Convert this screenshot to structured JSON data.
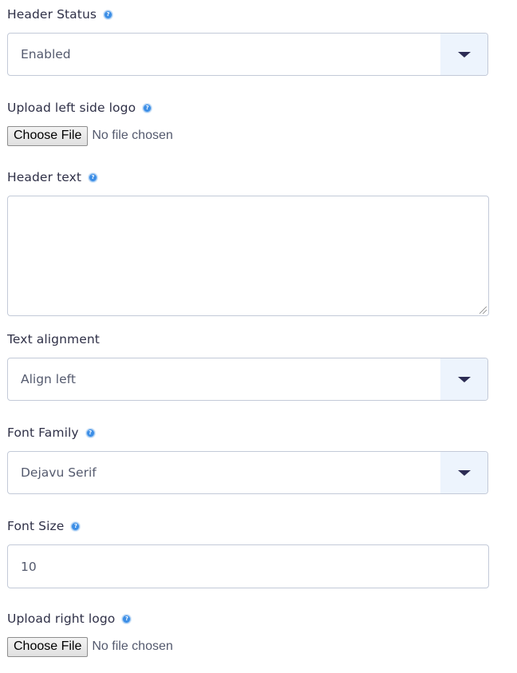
{
  "form": {
    "header_status": {
      "label": "Header Status",
      "help_icon": "help-circle-icon",
      "value": "Enabled"
    },
    "upload_left_logo": {
      "label": "Upload left side logo",
      "help_icon": "help-circle-icon",
      "button_label": "Choose File",
      "status": "No file chosen"
    },
    "header_text": {
      "label": "Header text",
      "help_icon": "help-circle-icon",
      "value": ""
    },
    "text_alignment": {
      "label": "Text alignment",
      "value": "Align left"
    },
    "font_family": {
      "label": "Font Family",
      "help_icon": "help-circle-icon",
      "value": "Dejavu Serif"
    },
    "font_size": {
      "label": "Font Size",
      "help_icon": "help-circle-icon",
      "value": "10"
    },
    "upload_right_logo": {
      "label": "Upload right logo",
      "help_icon": "help-circle-icon",
      "button_label": "Choose File",
      "status": "No file chosen"
    }
  },
  "colors": {
    "label_text": "#2f3047",
    "field_border": "#c3cad8",
    "dropdown_arrow_bg": "#edf4fd",
    "caret": "#2c2c54",
    "help_icon": "#3c8ee6"
  }
}
